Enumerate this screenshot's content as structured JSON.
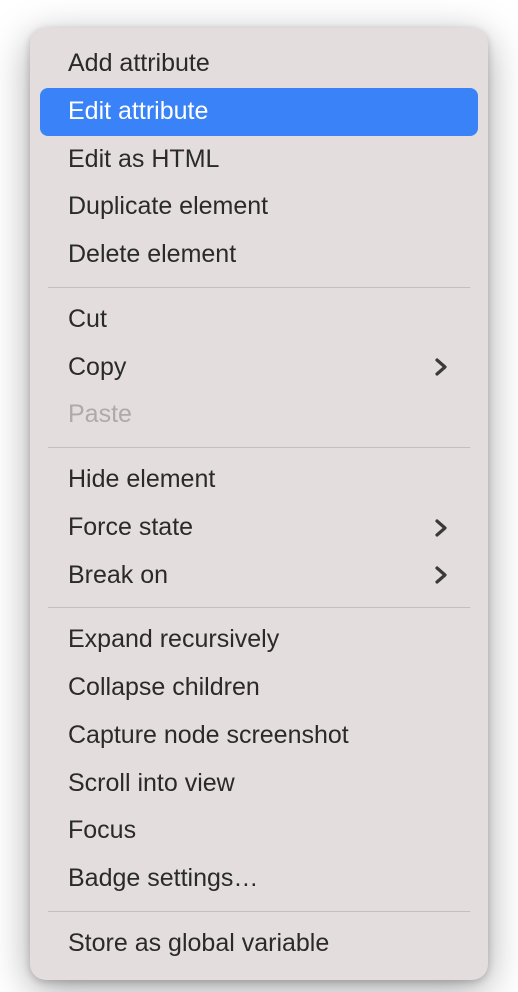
{
  "menu": {
    "groups": [
      {
        "items": [
          {
            "key": "add-attribute",
            "label": "Add attribute",
            "submenu": false,
            "disabled": false,
            "selected": false
          },
          {
            "key": "edit-attribute",
            "label": "Edit attribute",
            "submenu": false,
            "disabled": false,
            "selected": true
          },
          {
            "key": "edit-as-html",
            "label": "Edit as HTML",
            "submenu": false,
            "disabled": false,
            "selected": false
          },
          {
            "key": "duplicate-element",
            "label": "Duplicate element",
            "submenu": false,
            "disabled": false,
            "selected": false
          },
          {
            "key": "delete-element",
            "label": "Delete element",
            "submenu": false,
            "disabled": false,
            "selected": false
          }
        ]
      },
      {
        "items": [
          {
            "key": "cut",
            "label": "Cut",
            "submenu": false,
            "disabled": false,
            "selected": false
          },
          {
            "key": "copy",
            "label": "Copy",
            "submenu": true,
            "disabled": false,
            "selected": false
          },
          {
            "key": "paste",
            "label": "Paste",
            "submenu": false,
            "disabled": true,
            "selected": false
          }
        ]
      },
      {
        "items": [
          {
            "key": "hide-element",
            "label": "Hide element",
            "submenu": false,
            "disabled": false,
            "selected": false
          },
          {
            "key": "force-state",
            "label": "Force state",
            "submenu": true,
            "disabled": false,
            "selected": false
          },
          {
            "key": "break-on",
            "label": "Break on",
            "submenu": true,
            "disabled": false,
            "selected": false
          }
        ]
      },
      {
        "items": [
          {
            "key": "expand-recursively",
            "label": "Expand recursively",
            "submenu": false,
            "disabled": false,
            "selected": false
          },
          {
            "key": "collapse-children",
            "label": "Collapse children",
            "submenu": false,
            "disabled": false,
            "selected": false
          },
          {
            "key": "capture-node-screenshot",
            "label": "Capture node screenshot",
            "submenu": false,
            "disabled": false,
            "selected": false
          },
          {
            "key": "scroll-into-view",
            "label": "Scroll into view",
            "submenu": false,
            "disabled": false,
            "selected": false
          },
          {
            "key": "focus",
            "label": "Focus",
            "submenu": false,
            "disabled": false,
            "selected": false
          },
          {
            "key": "badge-settings",
            "label": "Badge settings…",
            "submenu": false,
            "disabled": false,
            "selected": false
          }
        ]
      },
      {
        "items": [
          {
            "key": "store-as-global-variable",
            "label": "Store as global variable",
            "submenu": false,
            "disabled": false,
            "selected": false
          }
        ]
      }
    ]
  }
}
